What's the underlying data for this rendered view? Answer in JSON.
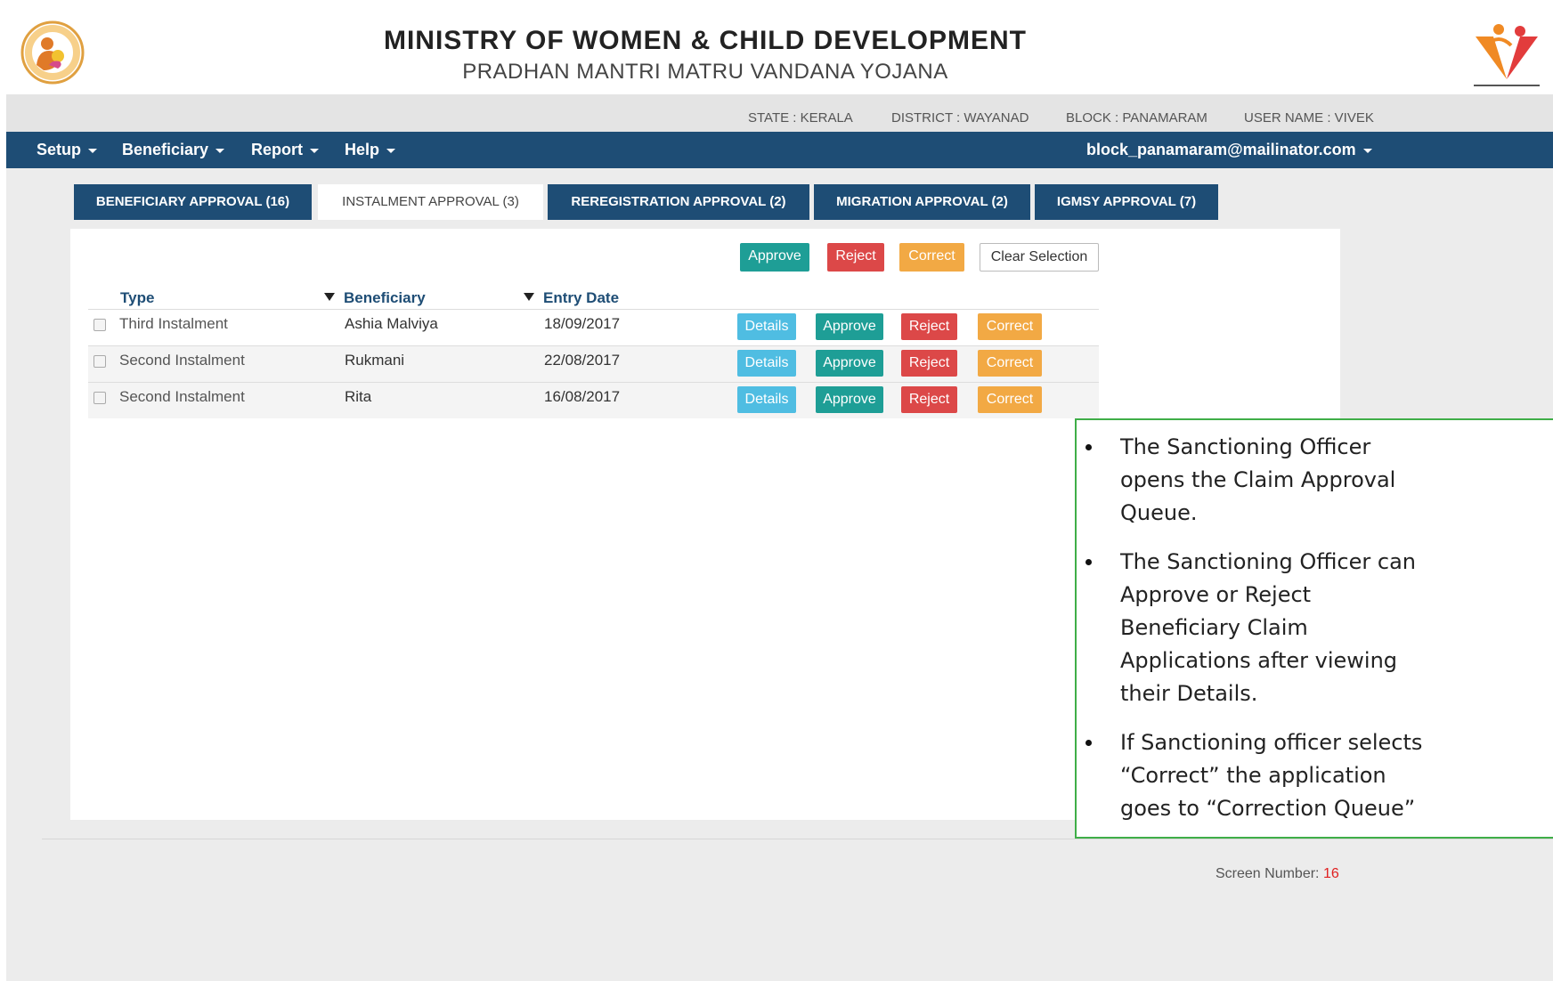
{
  "header": {
    "title": "MINISTRY OF WOMEN & CHILD DEVELOPMENT",
    "subtitle": "PRADHAN MANTRI MATRU VANDANA YOJANA"
  },
  "info": {
    "state": "STATE : KERALA",
    "district": "DISTRICT : WAYANAD",
    "block": "BLOCK : PANAMARAM",
    "user": "USER NAME : VIVEK"
  },
  "nav": {
    "setup": "Setup",
    "beneficiary": "Beneficiary",
    "report": "Report",
    "help": "Help",
    "account": "block_panamaram@mailinator.com"
  },
  "tabs": [
    {
      "label": "BENEFICIARY APPROVAL (16)"
    },
    {
      "label": "INSTALMENT APPROVAL (3)"
    },
    {
      "label": "REREGISTRATION APPROVAL (2)"
    },
    {
      "label": "MIGRATION APPROVAL (2)"
    },
    {
      "label": "IGMSY APPROVAL (7)"
    }
  ],
  "toolbar": {
    "approve": "Approve",
    "reject": "Reject",
    "correct": "Correct",
    "clear": "Clear Selection"
  },
  "table": {
    "columns": [
      "Type",
      "Beneficiary",
      "Entry Date"
    ],
    "rows": [
      {
        "type": "Third Instalment",
        "beneficiary": "Ashia Malviya",
        "date": "18/09/2017"
      },
      {
        "type": "Second Instalment",
        "beneficiary": "Rukmani",
        "date": "22/08/2017"
      },
      {
        "type": "Second Instalment",
        "beneficiary": "Rita",
        "date": "16/08/2017"
      }
    ],
    "actions": {
      "details": "Details",
      "approve": "Approve",
      "reject": "Reject",
      "correct": "Correct"
    }
  },
  "callout": [
    "The Sanctioning Officer opens the Claim Approval Queue.",
    "The Sanctioning Officer can Approve or Reject Beneficiary Claim Applications after viewing their Details.",
    "If Sanctioning officer selects “Correct” the application goes to “Correction Queue”"
  ],
  "footer": {
    "screen_label": "Screen Number:",
    "screen_number": "16"
  },
  "colors": {
    "navbar": "#1e4d75",
    "approve": "#1e9e96",
    "reject": "#dc4848",
    "correct": "#f2a944",
    "details": "#4fbde2",
    "callout_border": "#3fae48"
  }
}
